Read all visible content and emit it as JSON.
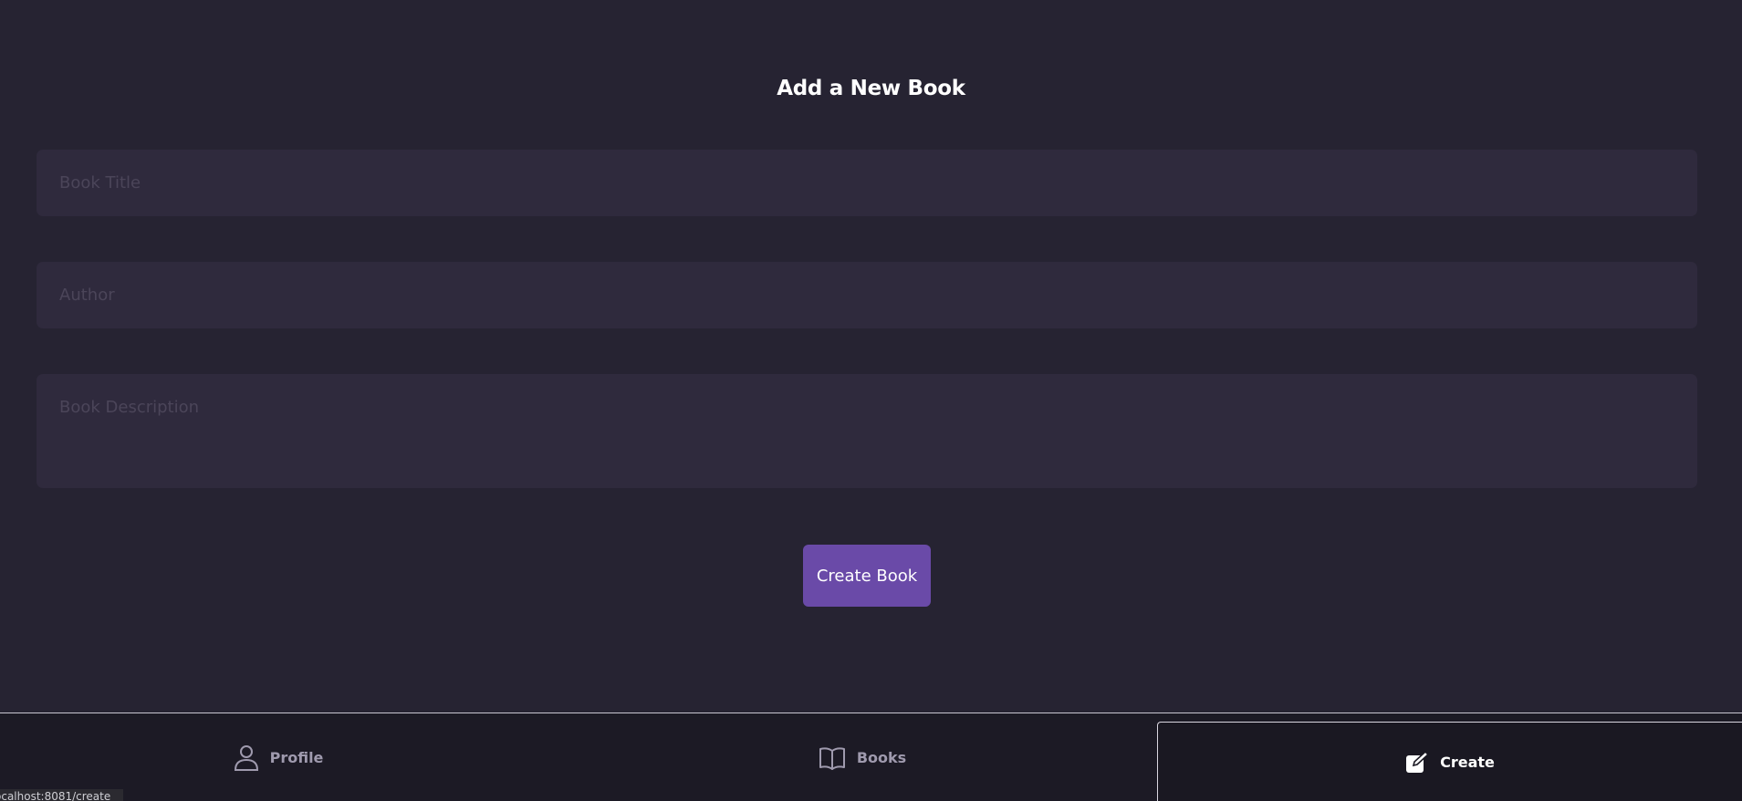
{
  "form": {
    "title": "Add a New Book",
    "book_title_placeholder": "Book Title",
    "author_placeholder": "Author",
    "description_placeholder": "Book Description",
    "submit_label": "Create Book"
  },
  "nav": {
    "items": [
      {
        "label": "Profile",
        "icon": "person-icon",
        "active": false
      },
      {
        "label": "Books",
        "icon": "open-book-icon",
        "active": false
      },
      {
        "label": "Create",
        "icon": "edit-square-icon",
        "active": true
      }
    ]
  },
  "status_bar": {
    "url": "ocalhost:8081/create"
  },
  "colors": {
    "background": "#262332",
    "input_background": "#2f2a3d",
    "accent": "#6a4aa8",
    "nav_background": "#1c1a25",
    "nav_inactive_text": "#9f9aae"
  }
}
